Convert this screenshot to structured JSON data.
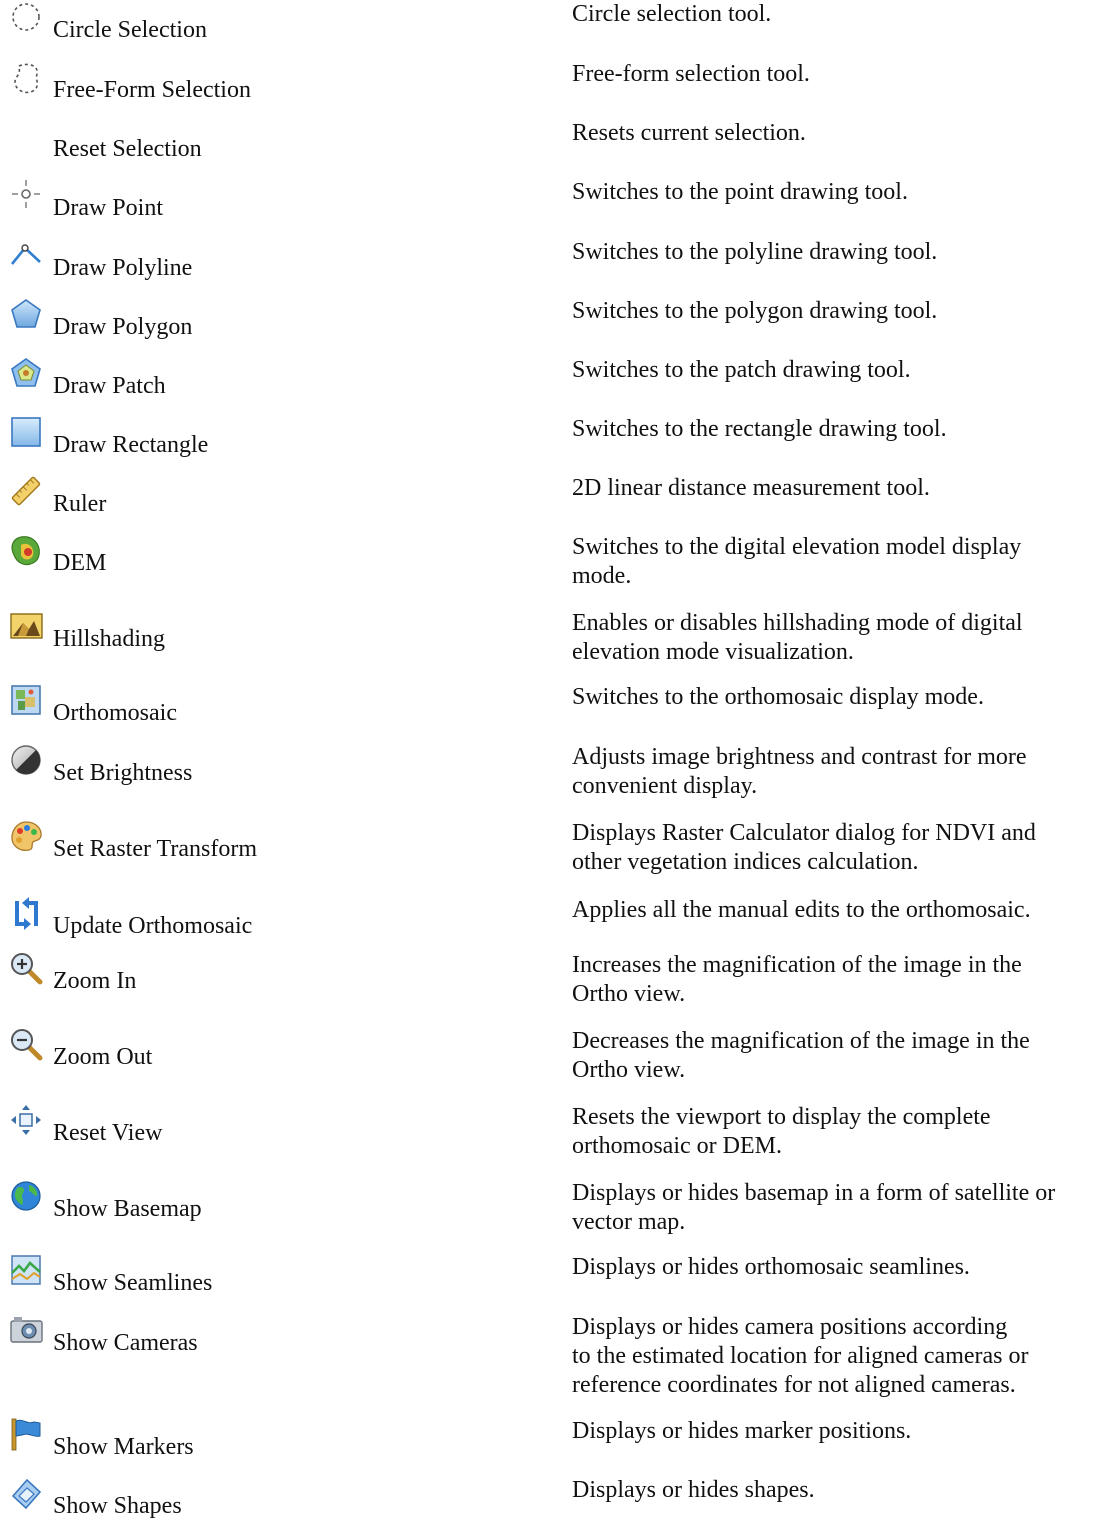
{
  "rows": [
    {
      "label": "Circle Selection",
      "icon": "circle-selection-icon",
      "desc": [
        "Circle selection tool."
      ]
    },
    {
      "label": "Free-Form Selection",
      "icon": "free-form-selection-icon",
      "desc": [
        "Free-form selection tool."
      ]
    },
    {
      "label": "Reset Selection",
      "icon": "",
      "desc": [
        "Resets current selection."
      ]
    },
    {
      "label": "Draw Point",
      "icon": "draw-point-icon",
      "desc": [
        "Switches to the point drawing tool."
      ]
    },
    {
      "label": "Draw Polyline",
      "icon": "draw-polyline-icon",
      "desc": [
        "Switches to the polyline drawing tool."
      ]
    },
    {
      "label": "Draw Polygon",
      "icon": "draw-polygon-icon",
      "desc": [
        "Switches to the polygon drawing tool."
      ]
    },
    {
      "label": "Draw Patch",
      "icon": "draw-patch-icon",
      "desc": [
        "Switches to the patch drawing tool."
      ]
    },
    {
      "label": "Draw Rectangle",
      "icon": "draw-rectangle-icon",
      "desc": [
        "Switches to the rectangle drawing tool."
      ]
    },
    {
      "label": "Ruler",
      "icon": "ruler-icon",
      "desc": [
        "2D linear distance measurement tool."
      ]
    },
    {
      "label": "DEM",
      "icon": "dem-icon",
      "desc": [
        "Switches to the digital elevation model display",
        "mode."
      ]
    },
    {
      "label": "Hillshading",
      "icon": "hillshading-icon",
      "desc": [
        "Enables or disables hillshading mode of digital",
        "elevation mode visualization."
      ]
    },
    {
      "label": "Orthomosaic",
      "icon": "orthomosaic-icon",
      "desc": [
        "Switches to the orthomosaic display mode."
      ]
    },
    {
      "label": "Set Brightness",
      "icon": "brightness-icon",
      "desc": [
        "Adjusts image brightness and contrast for more",
        "convenient display."
      ]
    },
    {
      "label": "Set Raster Transform",
      "icon": "palette-icon",
      "desc": [
        "Displays Raster Calculator dialog for NDVI and",
        "other vegetation indices calculation."
      ]
    },
    {
      "label": "Update Orthomosaic",
      "icon": "update-icon",
      "desc": [
        "Applies all the manual edits to the orthomosaic."
      ]
    },
    {
      "label": "Zoom In",
      "icon": "zoom-in-icon",
      "desc": [
        "Increases the magnification of the image in the",
        "Ortho view."
      ]
    },
    {
      "label": "Zoom Out",
      "icon": "zoom-out-icon",
      "desc": [
        "Decreases the magnification of the image in the",
        "Ortho view."
      ]
    },
    {
      "label": "Reset View",
      "icon": "reset-view-icon",
      "desc": [
        "Resets the viewport to display the complete",
        "orthomosaic or DEM."
      ]
    },
    {
      "label": "Show Basemap",
      "icon": "globe-icon",
      "desc": [
        "Displays or hides basemap in a form of satellite or",
        "vector map."
      ]
    },
    {
      "label": "Show Seamlines",
      "icon": "seamlines-icon",
      "desc": [
        "Displays or hides orthomosaic seamlines."
      ]
    },
    {
      "label": "Show Cameras",
      "icon": "camera-icon",
      "desc": [
        "Displays or hides camera positions according",
        "to the estimated location for aligned cameras or",
        "reference coordinates for not aligned cameras."
      ]
    },
    {
      "label": "Show Markers",
      "icon": "flag-icon",
      "desc": [
        "Displays or hides marker positions."
      ]
    },
    {
      "label": "Show Shapes",
      "icon": "shapes-icon",
      "desc": [
        "Displays or hides shapes."
      ]
    }
  ]
}
